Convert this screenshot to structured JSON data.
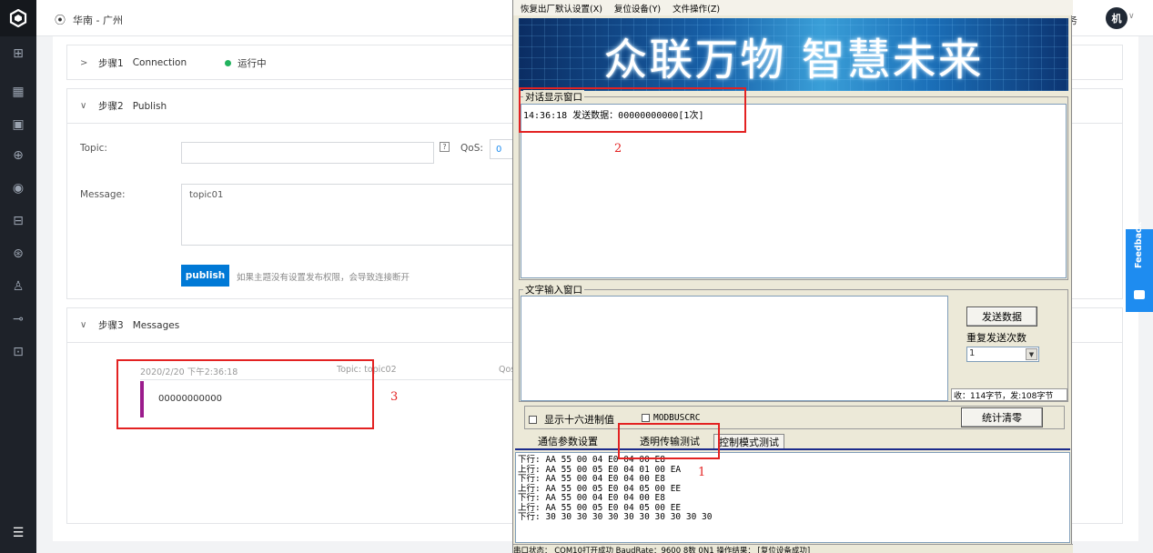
{
  "topbar": {
    "region": "华南 - 广州",
    "right_label": "务",
    "avatar": "机"
  },
  "sidebar": {
    "icons": [
      "dashboard-icon",
      "grid-icon",
      "device-icon",
      "list-icon",
      "rule-icon",
      "view-icon",
      "monitor-icon",
      "plug-icon",
      "user-icon",
      "link-icon",
      "box-icon"
    ]
  },
  "steps": {
    "step1": {
      "title": "步骤1",
      "name": "Connection",
      "status": "运行中",
      "status_color": "#22b35e"
    },
    "step2": {
      "title": "步骤2",
      "name": "Publish",
      "topic_label": "Topic:",
      "topic_value": "",
      "help": "?",
      "qos_label": "QoS:",
      "qos_value": "0",
      "message_label": "Message:",
      "message_value": "topic01",
      "publish_label": "publish",
      "hint": "如果主题没有设置发布权限，会导致连接断开"
    },
    "step3": {
      "title": "步骤3",
      "name": "Messages",
      "time": "2020/2/20 下午2:36:18",
      "topic": "Topic: topic02",
      "qos": "Qos",
      "payload": "00000000000",
      "bar_color": "#9b1c8c"
    }
  },
  "feedback": {
    "label": "Feedback"
  },
  "dialog": {
    "menu": [
      "恢复出厂默认设置(X)",
      "复位设备(Y)",
      "文件操作(Z)"
    ],
    "banner": "众联万物  智慧未来",
    "chat_title": "对话显示窗口",
    "chat_line": "14:36:18 发送数据：00000000000[1次]",
    "input_title": "文字输入窗口",
    "send_button": "发送数据",
    "repeat_label": "重复发送次数",
    "repeat_value": "1",
    "counter": "收：114字节，发:108字节",
    "hex_label": "显示十六进制值",
    "crc_label": "MODBUSCRC",
    "clear_button": "统计清零",
    "tabs": [
      "通信参数设置",
      "透明传输测试",
      "控制模式测试"
    ],
    "log": [
      "下行: AA 55 00 04 E0 04 00 E8",
      "上行: AA 55 00 05 E0 04 01 00 EA",
      "下行: AA 55 00 04 E0 04 00 E8",
      "上行: AA 55 00 05 E0 04 05 00 EE",
      "下行: AA 55 00 04 E0 04 00 E8",
      "上行: AA 55 00 05 E0 04 05 00 EE",
      "下行: 30 30 30 30 30 30 30 30 30 30 30"
    ],
    "status": "串口状态：    COM10打开成功 BaudRate：9600 8数 0N1        操作结果：    [复位设备成功]"
  },
  "annotations": [
    "2",
    "3",
    "1"
  ],
  "annotation_color": "#e32222"
}
